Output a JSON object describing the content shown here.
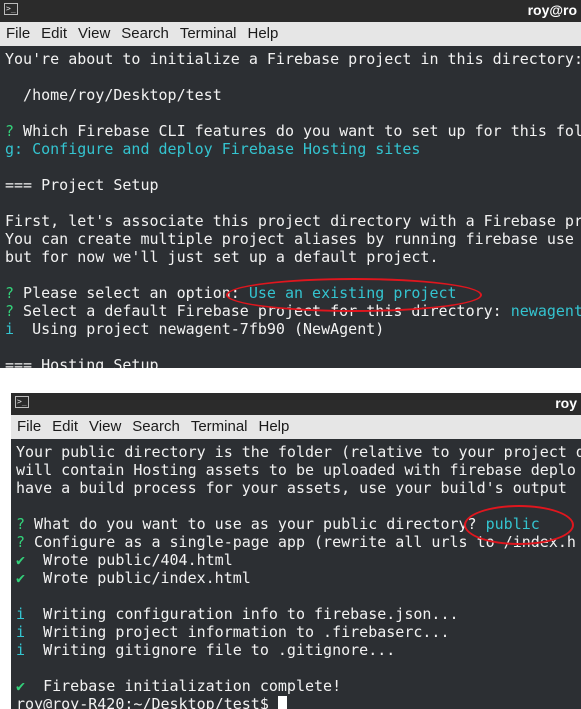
{
  "colors": {
    "terminal_bg": "#2c2f33",
    "prompt_green": "#33d17a",
    "answer_cyan": "#34c4d0",
    "highlight_red": "#e0161e"
  },
  "window1": {
    "title": "roy@ro",
    "menu": [
      "File",
      "Edit",
      "View",
      "Search",
      "Terminal",
      "Help"
    ],
    "lines": {
      "l1": "You're about to initialize a Firebase project in this directory:",
      "l2": "  /home/roy/Desktop/test",
      "l3_q": "?",
      "l3_t": " Which Firebase CLI features do you want to set up for this fold",
      "l4": "g: Configure and deploy Firebase Hosting sites",
      "l5": "=== Project Setup",
      "l6": "First, let's associate this project directory with a Firebase pr",
      "l7": "You can create multiple project aliases by running firebase use",
      "l8": "but for now we'll just set up a default project.",
      "l9_q": "?",
      "l9_t": " Please select an option: ",
      "l9_a": "Use an existing project",
      "l10_q": "?",
      "l10_t": " Select a default Firebase project for this directory: ",
      "l10_a": "newagent",
      "l11_i": "i",
      "l11_t": "  Using project newagent-7fb90 (NewAgent)",
      "l12": "=== Hosting Setup"
    }
  },
  "window2": {
    "title": "roy",
    "menu": [
      "File",
      "Edit",
      "View",
      "Search",
      "Terminal",
      "Help"
    ],
    "lines": {
      "l1": "Your public directory is the folder (relative to your project d",
      "l2": "will contain Hosting assets to be uploaded with firebase deplo",
      "l3": "have a build process for your assets, use your build's output",
      "l4_q": "?",
      "l4_t": " What do you want to use as your public directory? ",
      "l4_a": "public",
      "l5_q": "?",
      "l5_t": " Configure as a single-page app (rewrite all urls to /index.h",
      "l6_c": "✔",
      "l6_t": "  Wrote public/404.html",
      "l7_c": "✔",
      "l7_t": "  Wrote public/index.html",
      "l8_i": "i",
      "l8_t": "  Writing configuration info to firebase.json...",
      "l9_i": "i",
      "l9_t": "  Writing project information to .firebaserc...",
      "l10_i": "i",
      "l10_t": "  Writing gitignore file to .gitignore...",
      "l11_c": "✔",
      "l11_t": "  Firebase initialization complete!",
      "l12": "roy@roy-R420:~/Desktop/test$ "
    }
  }
}
